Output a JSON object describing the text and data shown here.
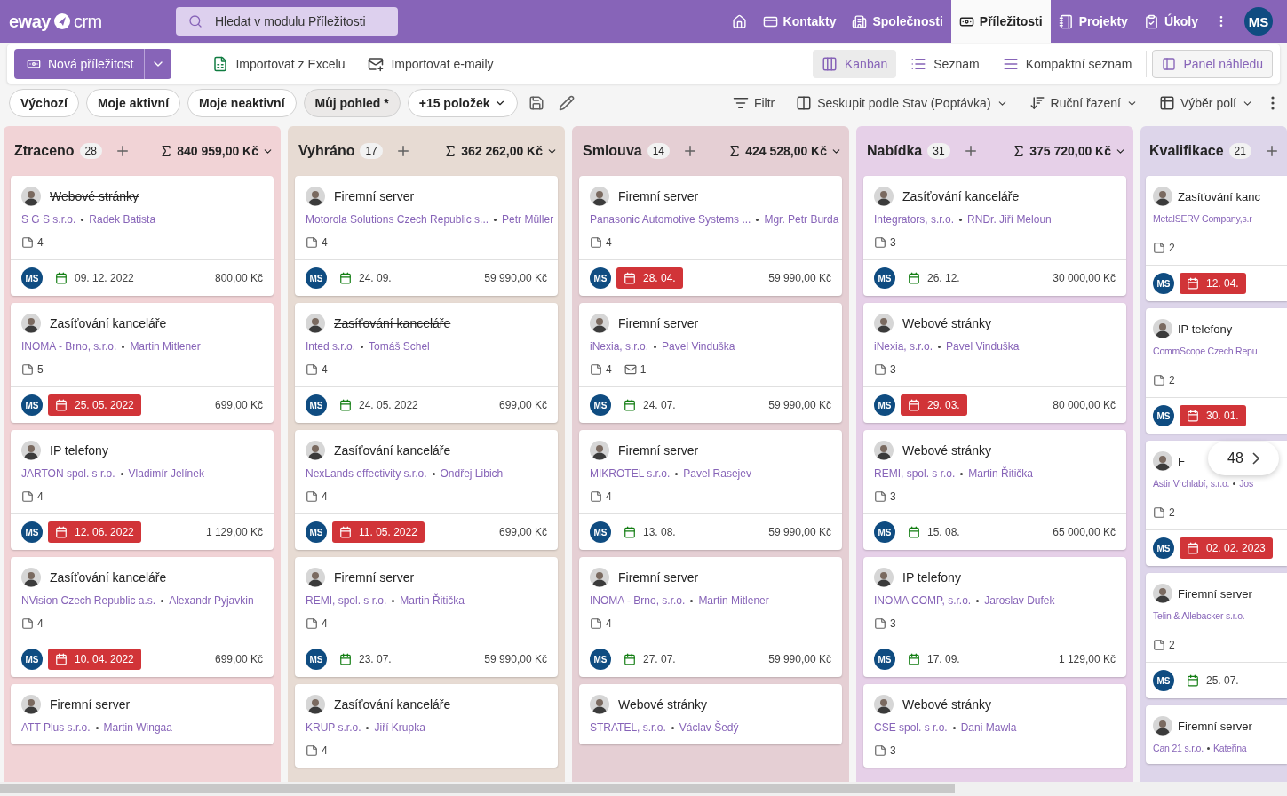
{
  "logo": {
    "left": "eway",
    "right": "crm"
  },
  "search": {
    "placeholder": "Hledat v modulu Příležitosti"
  },
  "nav": [
    {
      "kind": "home",
      "selected": false
    },
    {
      "kind": "contacts",
      "label": "Kontakty",
      "selected": false
    },
    {
      "kind": "companies",
      "label": "Společnosti",
      "selected": false
    },
    {
      "kind": "deals",
      "label": "Příležitosti",
      "selected": true
    },
    {
      "kind": "projects",
      "label": "Projekty",
      "selected": false
    },
    {
      "kind": "tasks",
      "label": "Úkoly",
      "selected": false
    }
  ],
  "user": "MS",
  "toolbar": {
    "new": "Nová příležitost",
    "actions": [
      {
        "kind": "excel",
        "label": "Importovat z Excelu"
      },
      {
        "kind": "mail",
        "label": "Importovat e-maily"
      }
    ],
    "views": [
      {
        "kind": "kanban",
        "label": "Kanban",
        "selected": true
      },
      {
        "kind": "list",
        "label": "Seznam",
        "selected": false
      },
      {
        "kind": "compact",
        "label": "Kompaktní seznam",
        "selected": false
      }
    ],
    "preview": "Panel náhledu"
  },
  "saved_views": [
    {
      "label": "Výchozí",
      "selected": false
    },
    {
      "label": "Moje aktivní",
      "selected": false
    },
    {
      "label": "Moje neaktivní",
      "selected": false
    },
    {
      "label": "Můj pohled *",
      "selected": true
    }
  ],
  "more_views": "+15 položek",
  "commands": [
    {
      "kind": "filter",
      "label": "Filtr",
      "menu": false
    },
    {
      "kind": "group",
      "label": "Seskupit podle Stav (Poptávka)",
      "menu": true
    },
    {
      "kind": "sort",
      "label": "Ruční řazení",
      "menu": true
    },
    {
      "kind": "fields",
      "label": "Výběr polí",
      "menu": true
    }
  ],
  "columns": [
    {
      "title": "Ztraceno",
      "count": "28",
      "total": "840 959,00 Kč",
      "color": "#f1d3d6",
      "cards": [
        {
          "title": "Webové stránky",
          "struck": true,
          "company": "S G S s.r.o.",
          "contact": "Radek Batista",
          "notes": "4",
          "date": "09. 12. 2022",
          "overdue": false,
          "amount": "800,00 Kč",
          "owner": "MS"
        },
        {
          "title": "Zasíťování kanceláře",
          "struck": false,
          "company": "INOMA - Brno, s.r.o.",
          "contact": "Martin Mitlener",
          "notes": "5",
          "date": "25. 05. 2022",
          "overdue": true,
          "amount": "699,00 Kč",
          "owner": "MS"
        },
        {
          "title": "IP telefony",
          "struck": false,
          "company": "JARTON spol. s r.o.",
          "contact": "Vladimír Jelínek",
          "notes": "4",
          "date": "12. 06. 2022",
          "overdue": true,
          "amount": "1 129,00 Kč",
          "owner": "MS"
        },
        {
          "title": "Zasíťování kanceláře",
          "struck": false,
          "company": "NVision Czech Republic a.s.",
          "contact": "Alexandr Pyjavkin",
          "notes": "4",
          "date": "10. 04. 2022",
          "overdue": true,
          "amount": "699,00 Kč",
          "owner": "MS"
        },
        {
          "title": "Firemní server",
          "struck": false,
          "company": "ATT Plus s.r.o.",
          "contact": "Martin Wingaa"
        }
      ]
    },
    {
      "title": "Vyhráno",
      "count": "17",
      "total": "362 262,00 Kč",
      "color": "#e7dbd3",
      "cards": [
        {
          "title": "Firemní server",
          "struck": false,
          "company": "Motorola Solutions Czech Republic s...",
          "contact": "Petr Müller",
          "notes": "4",
          "date": "24. 09.",
          "overdue": false,
          "amount": "59 990,00 Kč",
          "owner": "MS"
        },
        {
          "title": "Zasíťování kanceláře",
          "struck": true,
          "company": "Inted s.r.o.",
          "contact": "Tomáš Schel",
          "notes": "4",
          "date": "24. 05. 2022",
          "overdue": false,
          "amount": "699,00 Kč",
          "owner": "MS"
        },
        {
          "title": "Zasíťování kanceláře",
          "struck": false,
          "company": "NexLands effectivity s.r.o.",
          "contact": "Ondřej Libich",
          "notes": "4",
          "date": "11. 05. 2022",
          "overdue": true,
          "amount": "699,00 Kč",
          "owner": "MS"
        },
        {
          "title": "Firemní server",
          "struck": false,
          "company": "REMI, spol. s r.o.",
          "contact": "Martin Řitička",
          "notes": "4",
          "date": "23. 07.",
          "overdue": false,
          "amount": "59 990,00 Kč",
          "owner": "MS"
        },
        {
          "title": "Zasíťování kanceláře",
          "struck": false,
          "company": "KRUP s.r.o.",
          "contact": "Jiří Krupka",
          "notes": "4"
        }
      ]
    },
    {
      "title": "Smlouva",
      "count": "14",
      "total": "424 528,00 Kč",
      "color": "#e5cfd4",
      "cards": [
        {
          "title": "Firemní server",
          "struck": false,
          "company": "Panasonic Automotive Systems ...",
          "contact": "Mgr. Petr Burda",
          "notes": "4",
          "date": "28. 04.",
          "overdue": true,
          "amount": "59 990,00 Kč",
          "owner": "MS"
        },
        {
          "title": "Firemní server",
          "struck": false,
          "company": "iNexia, s.r.o.",
          "contact": "Pavel Vinduška",
          "notes": "4",
          "mails": "1",
          "date": "24. 07.",
          "overdue": false,
          "amount": "59 990,00 Kč",
          "owner": "MS"
        },
        {
          "title": "Firemní server",
          "struck": false,
          "company": "MIKROTEL s.r.o.",
          "contact": "Pavel Rasejev",
          "notes": "4",
          "date": "13. 08.",
          "overdue": false,
          "amount": "59 990,00 Kč",
          "owner": "MS"
        },
        {
          "title": "Firemní server",
          "struck": false,
          "company": "INOMA - Brno, s.r.o.",
          "contact": "Martin Mitlener",
          "notes": "4",
          "date": "27. 07.",
          "overdue": false,
          "amount": "59 990,00 Kč",
          "owner": "MS"
        },
        {
          "title": "Webové stránky",
          "struck": false,
          "company": "STRATEL, s.r.o.",
          "contact": "Václav Šedý"
        }
      ]
    },
    {
      "title": "Nabídka",
      "count": "31",
      "total": "375 720,00 Kč",
      "color": "#e6d0e8",
      "cards": [
        {
          "title": "Zasíťování kanceláře",
          "struck": false,
          "company": "Integrators, s.r.o.",
          "contact": "RNDr. Jiří Meloun",
          "notes": "3",
          "date": "26. 12.",
          "overdue": false,
          "amount": "30 000,00 Kč",
          "owner": "MS"
        },
        {
          "title": "Webové stránky",
          "struck": false,
          "company": "iNexia, s.r.o.",
          "contact": "Pavel Vinduška",
          "notes": "3",
          "date": "29. 03.",
          "overdue": true,
          "amount": "80 000,00 Kč",
          "owner": "MS"
        },
        {
          "title": "Webové stránky",
          "struck": false,
          "company": "REMI, spol. s r.o.",
          "contact": "Martin Řitička",
          "notes": "3",
          "date": "15. 08.",
          "overdue": false,
          "amount": "65 000,00 Kč",
          "owner": "MS"
        },
        {
          "title": "IP telefony",
          "struck": false,
          "company": "INOMA COMP, s.r.o.",
          "contact": "Jaroslav Dufek",
          "notes": "3",
          "date": "17. 09.",
          "overdue": false,
          "amount": "1 129,00 Kč",
          "owner": "MS"
        },
        {
          "title": "Webové stránky",
          "struck": false,
          "company": "CSE spol. s r.o.",
          "contact": "Dani Mawla",
          "notes": "3"
        }
      ]
    },
    {
      "title": "Kvalifikace",
      "count": "21",
      "color": "#ddd5ea",
      "cards": [
        {
          "title": "Zasíťování kanc",
          "struck": false,
          "company": "MetalSERV Company,s.r",
          "notes": "2",
          "date": "12. 04.",
          "overdue": true,
          "owner": "MS"
        },
        {
          "title": "IP telefony",
          "struck": false,
          "company": "CommScope Czech Repu",
          "notes": "2",
          "date": "30. 01.",
          "overdue": true,
          "owner": "MS"
        },
        {
          "title": "F",
          "struck": false,
          "company": "Astir Vrchlabí, s.r.o.",
          "contact": "Jos",
          "notes": "2",
          "date": "02. 02. 2023",
          "overdue": true,
          "owner": "MS"
        },
        {
          "title": "Firemní server",
          "struck": false,
          "company": "Telin & Allebacker s.r.o.",
          "notes": "2",
          "date": "25. 07.",
          "overdue": false,
          "owner": "MS"
        },
        {
          "title": "Firemní server",
          "struck": false,
          "company": "Can 21 s.r.o.",
          "contact": "Kateřina"
        }
      ]
    }
  ],
  "pager": "48"
}
